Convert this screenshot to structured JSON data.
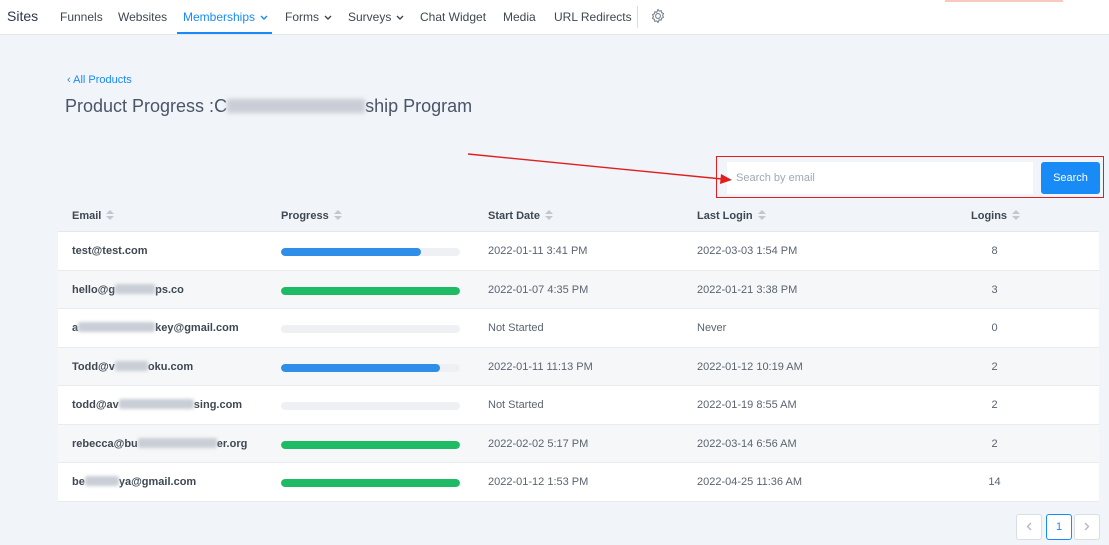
{
  "nav": {
    "brand": "Sites",
    "items": [
      {
        "label": "Funnels"
      },
      {
        "label": "Websites"
      },
      {
        "label": "Memberships"
      },
      {
        "label": "Forms"
      },
      {
        "label": "Surveys"
      },
      {
        "label": "Chat Widget"
      },
      {
        "label": "Media"
      },
      {
        "label": "URL Redirects"
      }
    ],
    "active_item": "Memberships",
    "settings_icon": "gear-icon"
  },
  "back_link": "‹ All Products",
  "page": {
    "title_prefix": "Product Progress :C",
    "title_suffix": "ship Program"
  },
  "search": {
    "placeholder": "Search by email",
    "value": "",
    "button_label": "Search"
  },
  "colors": {
    "accent": "#188bf6",
    "progress_partial": "#2f8ee8",
    "progress_complete": "#1fba64",
    "annotation": "#e11d1d"
  },
  "table": {
    "columns": [
      "Email",
      "Progress",
      "Start Date",
      "Last Login",
      "Logins"
    ],
    "rows": [
      {
        "email_a": "test@test.com",
        "email_b": "",
        "progress": 0.78,
        "complete": false,
        "start": "2022-01-11 3:41 PM",
        "last_login": "2022-03-03 1:54 PM",
        "logins": "8"
      },
      {
        "email_a": "hello@g",
        "email_b": "ps.co",
        "progress": 1.0,
        "complete": true,
        "start": "2022-01-07 4:35 PM",
        "last_login": "2022-01-21 3:38 PM",
        "logins": "3"
      },
      {
        "email_a": "a",
        "email_b": "key@gmail.com",
        "progress": 0,
        "complete": false,
        "start": "Not Started",
        "last_login": "Never",
        "logins": "0"
      },
      {
        "email_a": "Todd@v",
        "email_b": "oku.com",
        "progress": 0.89,
        "complete": false,
        "start": "2022-01-11 11:13 PM",
        "last_login": "2022-01-12 10:19 AM",
        "logins": "2"
      },
      {
        "email_a": "todd@av",
        "email_b": "sing.com",
        "progress": 0,
        "complete": false,
        "start": "Not Started",
        "last_login": "2022-01-19 8:55 AM",
        "logins": "2"
      },
      {
        "email_a": "rebecca@bu",
        "email_b": "er.org",
        "progress": 1.0,
        "complete": true,
        "start": "2022-02-02 5:17 PM",
        "last_login": "2022-03-14 6:56 AM",
        "logins": "2"
      },
      {
        "email_a": "be",
        "email_b": "ya@gmail.com",
        "progress": 1.0,
        "complete": true,
        "start": "2022-01-12 1:53 PM",
        "last_login": "2022-04-25 11:36 AM",
        "logins": "14"
      }
    ]
  },
  "pagination": {
    "prev_icon": "chevron-left-icon",
    "current_page": "1",
    "next_icon": "chevron-right-icon"
  }
}
